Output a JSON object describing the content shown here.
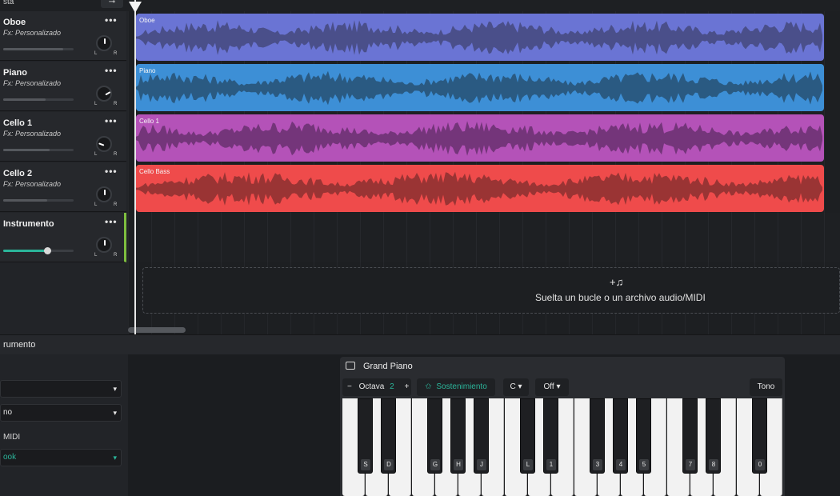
{
  "topbar": {
    "label": "sta",
    "button_icon": "pin-icon",
    "button_glyph": "⊸"
  },
  "tracks": [
    {
      "name": "Oboe",
      "fx": "Fx: Personalizado",
      "menu": "•••",
      "volume": 0.85,
      "pan_angle": 0
    },
    {
      "name": "Piano",
      "fx": "Fx: Personalizado",
      "menu": "•••",
      "volume": 0.6,
      "pan_angle": 60
    },
    {
      "name": "Cello 1",
      "fx": "Fx: Personalizado",
      "menu": "•••",
      "volume": 0.66,
      "pan_angle": -70
    },
    {
      "name": "Cello 2",
      "fx": "Fx: Personalizado",
      "menu": "•••",
      "volume": 0.62,
      "pan_angle": 0
    },
    {
      "name": "Instrumento",
      "fx": "",
      "menu": "•••",
      "volume": 0.62,
      "pan_angle": 0
    }
  ],
  "knob": {
    "left": "L",
    "right": "R"
  },
  "clips": [
    {
      "label": "Oboe",
      "color": "#6a74d4",
      "wave": "#4a4f8a"
    },
    {
      "label": "Piano",
      "color": "#3d8fd6",
      "wave": "#2a5a82"
    },
    {
      "label": "Cello 1",
      "color": "#b452b8",
      "wave": "#74357a"
    },
    {
      "label": "Cello Bass",
      "color": "#ef4b4b",
      "wave": "#9a3434"
    }
  ],
  "dropzone": {
    "icon": "+♫",
    "text": "Suelta un bucle o un archivo audio/MIDI"
  },
  "bottom_panel": {
    "title": "rumento",
    "selects": [
      {
        "value": "",
        "accent": false
      },
      {
        "value": "no",
        "accent": false
      },
      {
        "value": "ook",
        "accent": true
      }
    ],
    "midi_label": "MIDI",
    "accent": "#2bb59a"
  },
  "piano": {
    "title": "Grand Piano",
    "octave_minus": "−",
    "octave_label": "Octava",
    "octave_value": "2",
    "octave_plus": "+",
    "sustain_icon": "✩",
    "sustain_label": "Sostenimiento",
    "key_value": "C",
    "velocity_value": "Off",
    "pitch_label": "Tono",
    "black_key_labels": [
      "S",
      "D",
      "G",
      "H",
      "J",
      "L",
      "1",
      "3",
      "4",
      "5",
      "7",
      "8",
      "0"
    ]
  }
}
